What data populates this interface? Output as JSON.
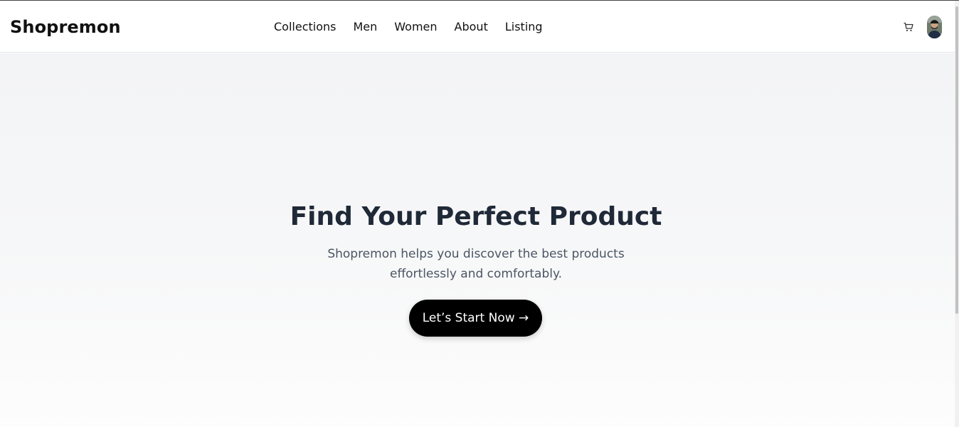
{
  "header": {
    "brand": "Shopremon",
    "nav": [
      "Collections",
      "Men",
      "Women",
      "About",
      "Listing"
    ],
    "cart_icon": "cart-icon",
    "avatar_icon": "avatar"
  },
  "hero": {
    "title": "Find Your Perfect Product",
    "subtitle": "Shopremon helps you discover the best products effortlessly and comfortably.",
    "cta_label": "Let’s Start Now →"
  },
  "colors": {
    "cta_bg": "#000000",
    "title": "#1f2937",
    "subtitle": "#4b5563",
    "hero_bg_top": "#f3f4f6"
  }
}
